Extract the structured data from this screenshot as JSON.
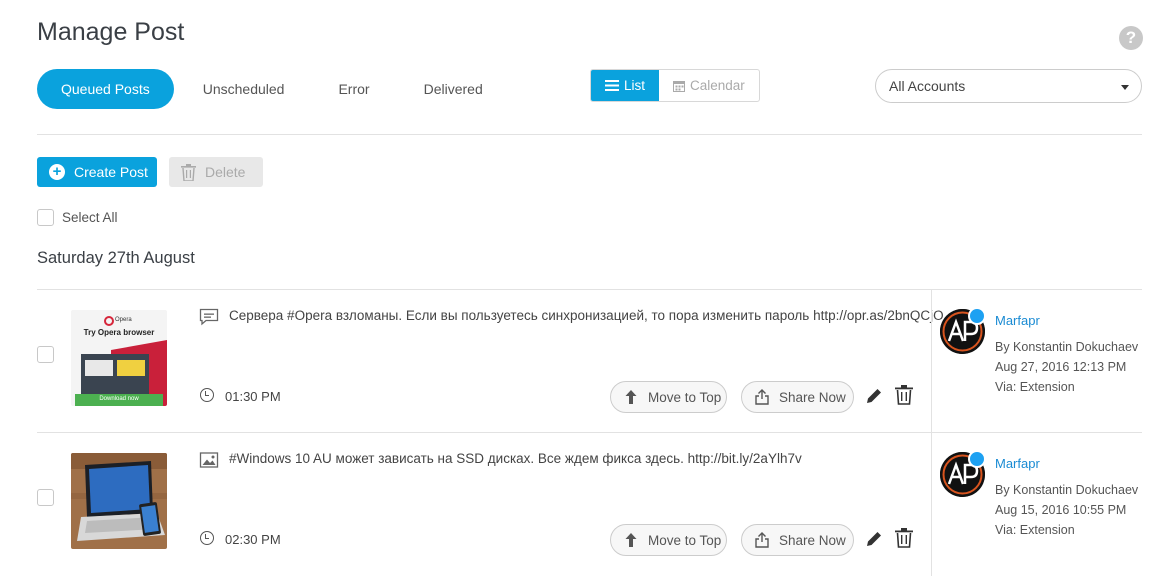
{
  "page": {
    "title": "Manage Post"
  },
  "tabs": [
    {
      "label": "Queued Posts",
      "active": true
    },
    {
      "label": "Unscheduled",
      "active": false
    },
    {
      "label": "Error",
      "active": false
    },
    {
      "label": "Delivered",
      "active": false
    }
  ],
  "view_toggle": {
    "list_label": "List",
    "calendar_label": "Calendar",
    "selected": "List"
  },
  "account_filter": {
    "value": "All Accounts"
  },
  "toolbar": {
    "create_label": "Create Post",
    "delete_label": "Delete"
  },
  "select_all_label": "Select All",
  "date_group": "Saturday 27th August",
  "actions": {
    "move_label": "Move to Top",
    "share_label": "Share Now"
  },
  "posts": [
    {
      "type_icon": "message-icon",
      "text": "Сервера #Opera взломаны. Если вы пользуетесь синхронизацией, то пора изменить пароль http://opr.as/2bnQCjO",
      "time": "01:30 PM",
      "thumb": {
        "brand": "Opera",
        "headline": "Try Opera browser",
        "cta": "Download now"
      },
      "account": "Marfapr",
      "author": "By Konstantin Dokuchaev",
      "date": "Aug 27, 2016 12:13 PM",
      "via": "Via: Extension"
    },
    {
      "type_icon": "image-icon",
      "text": "#Windows 10 AU может зависать на SSD дисках. Все ждем фикса здесь. http://bit.ly/2aYlh7v",
      "time": "02:30 PM",
      "account": "Marfapr",
      "author": "By Konstantin Dokuchaev",
      "date": "Aug 15, 2016 10:55 PM",
      "via": "Via: Extension"
    }
  ],
  "colors": {
    "accent": "#0aa2dd",
    "link": "#1a8bd3",
    "twitter": "#1da1f2"
  }
}
